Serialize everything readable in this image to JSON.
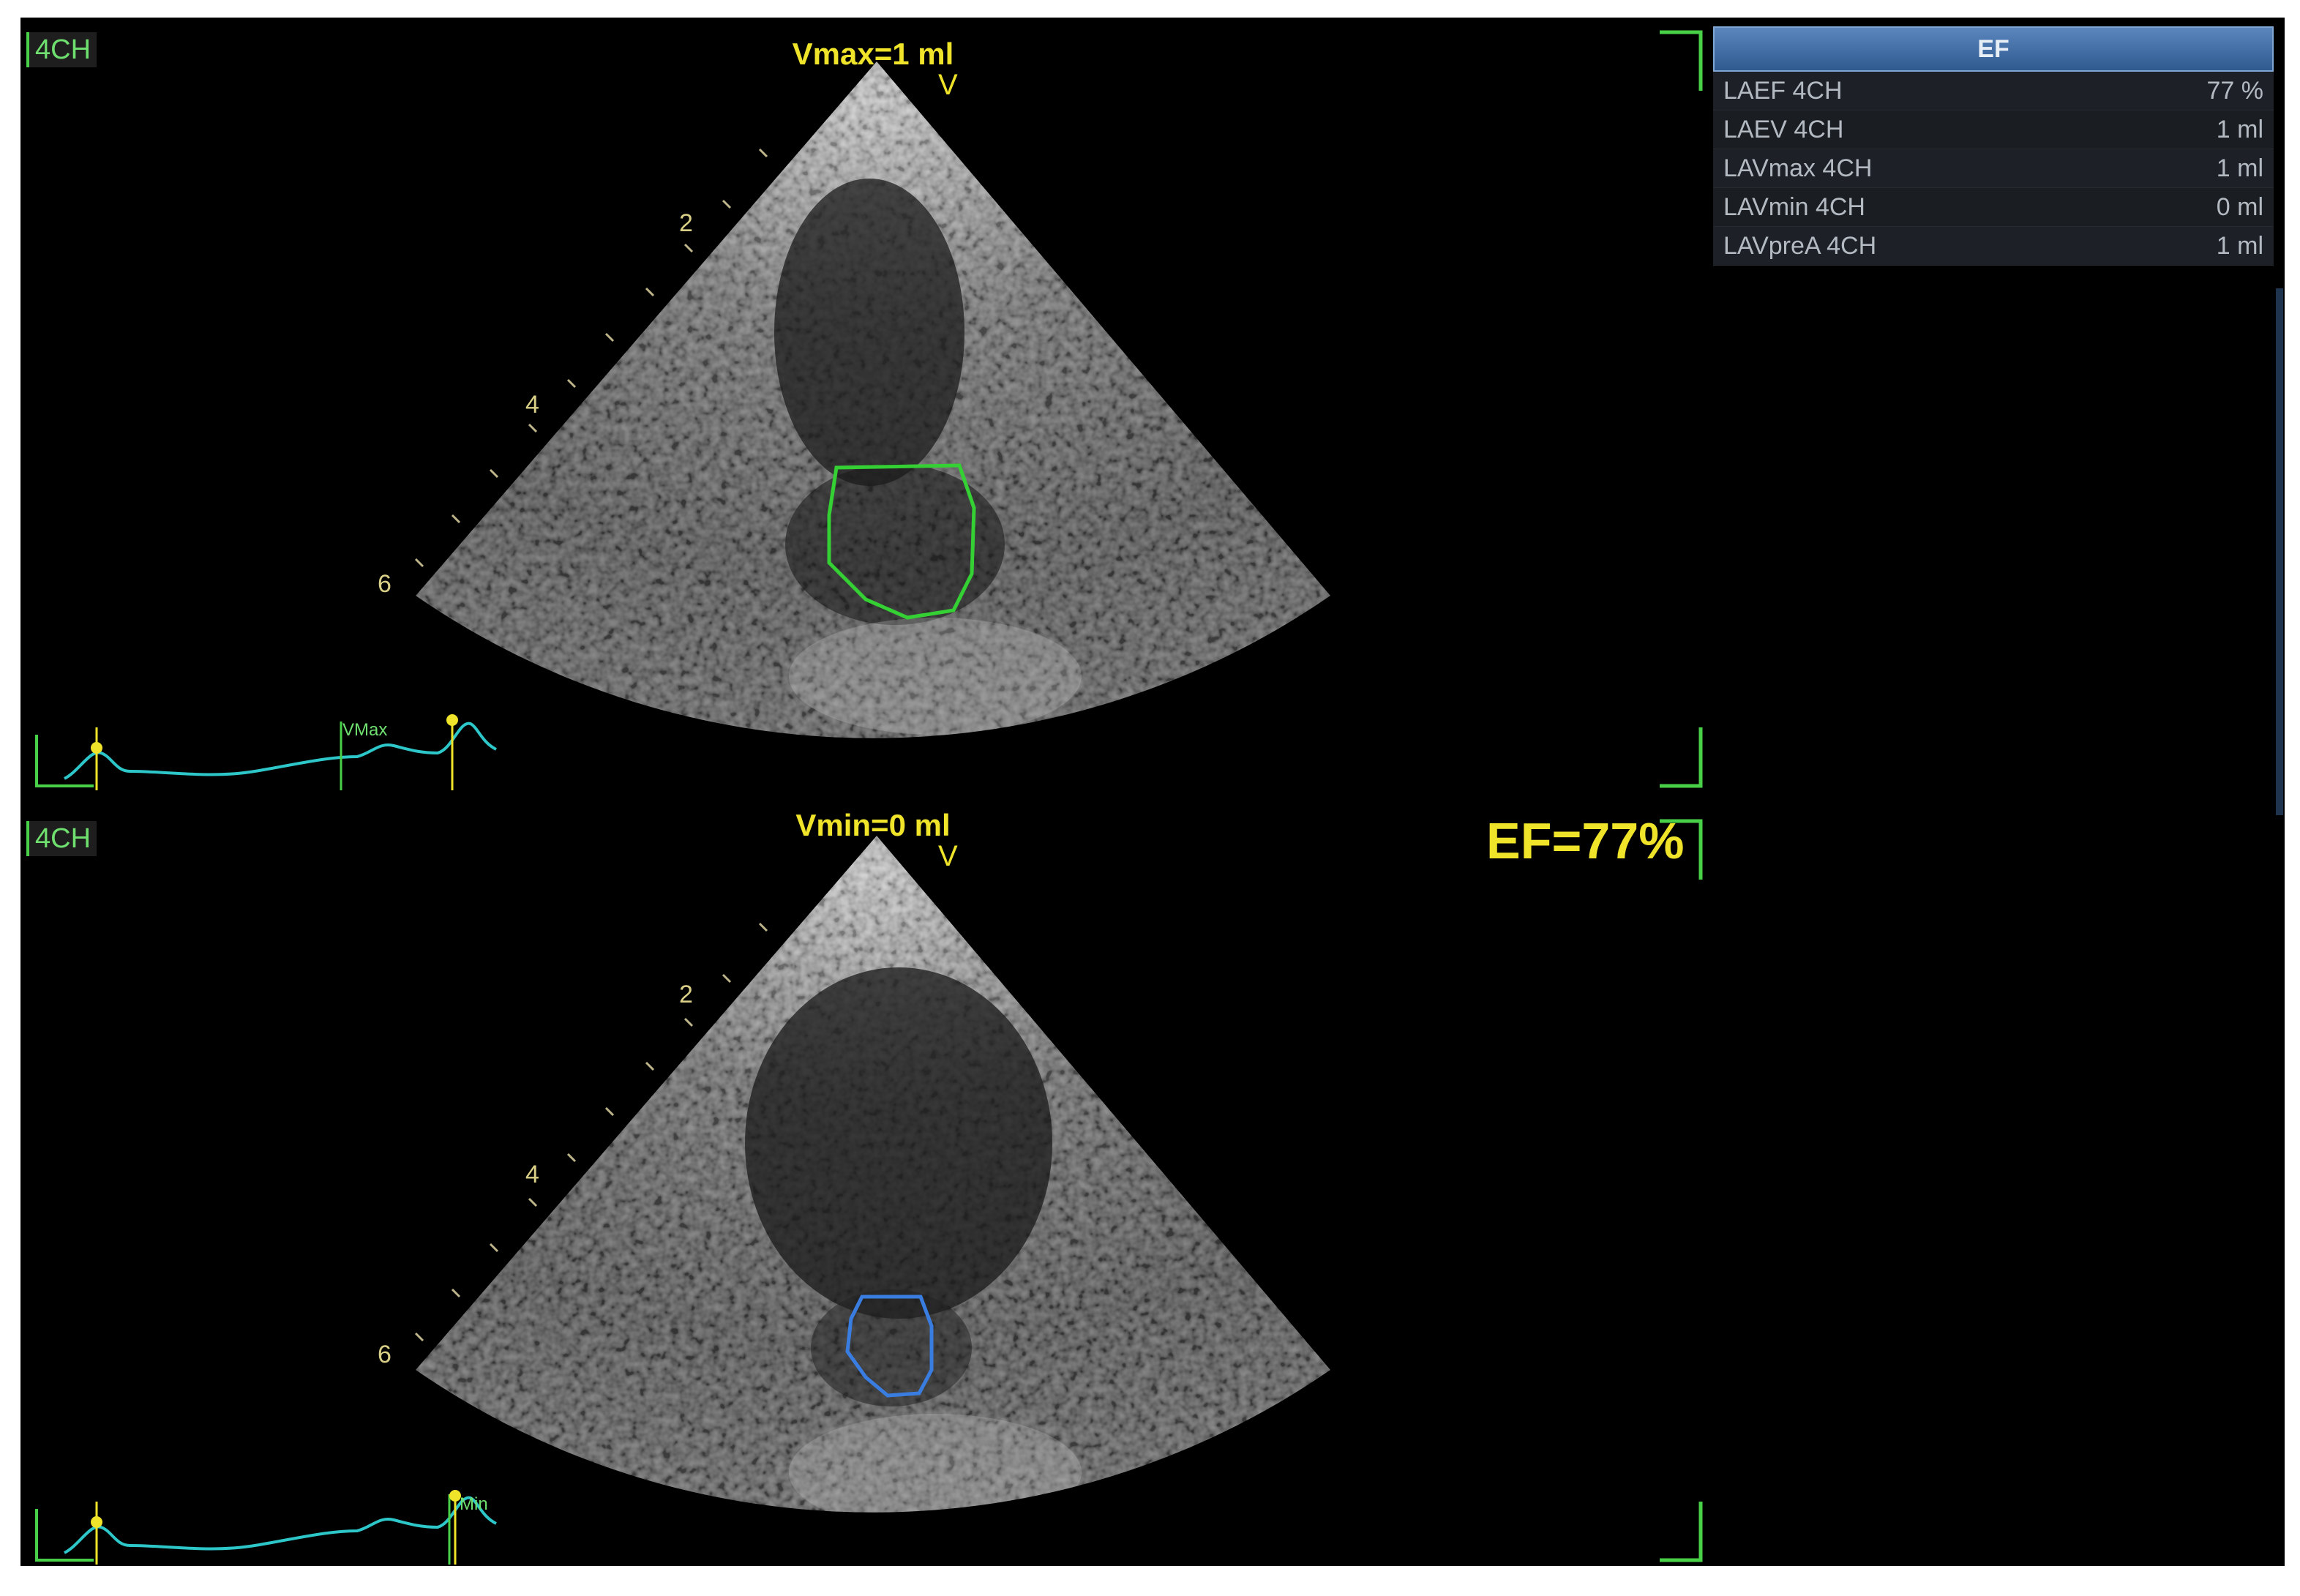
{
  "views": {
    "top": {
      "tag": "4CH",
      "label": "Vmax=1 ml",
      "v_marker": "V",
      "depth_labels": [
        "2",
        "4",
        "6"
      ],
      "ecg_marker": "VMax",
      "trace_color": "#34d034"
    },
    "bottom": {
      "tag": "4CH",
      "label": "Vmin=0 ml",
      "v_marker": "V",
      "depth_labels": [
        "2",
        "4",
        "6"
      ],
      "ecg_marker": "Min",
      "trace_color": "#3a7de0"
    }
  },
  "ef_result": "EF=77%",
  "ef_panel": {
    "title": "EF",
    "rows": [
      {
        "name": "LAEF 4CH",
        "value": "77 %"
      },
      {
        "name": "LAEV 4CH",
        "value": "1 ml"
      },
      {
        "name": "LAVmax 4CH",
        "value": "1 ml"
      },
      {
        "name": "LAVmin 4CH",
        "value": "0 ml"
      },
      {
        "name": "LAVpreA 4CH",
        "value": "1 ml"
      }
    ]
  },
  "colors": {
    "accent_yellow": "#f0e42a",
    "bracket_green": "#49d049",
    "ecg_cyan": "#2ec7c9",
    "panel_header_blue": "#3f6ea8"
  }
}
